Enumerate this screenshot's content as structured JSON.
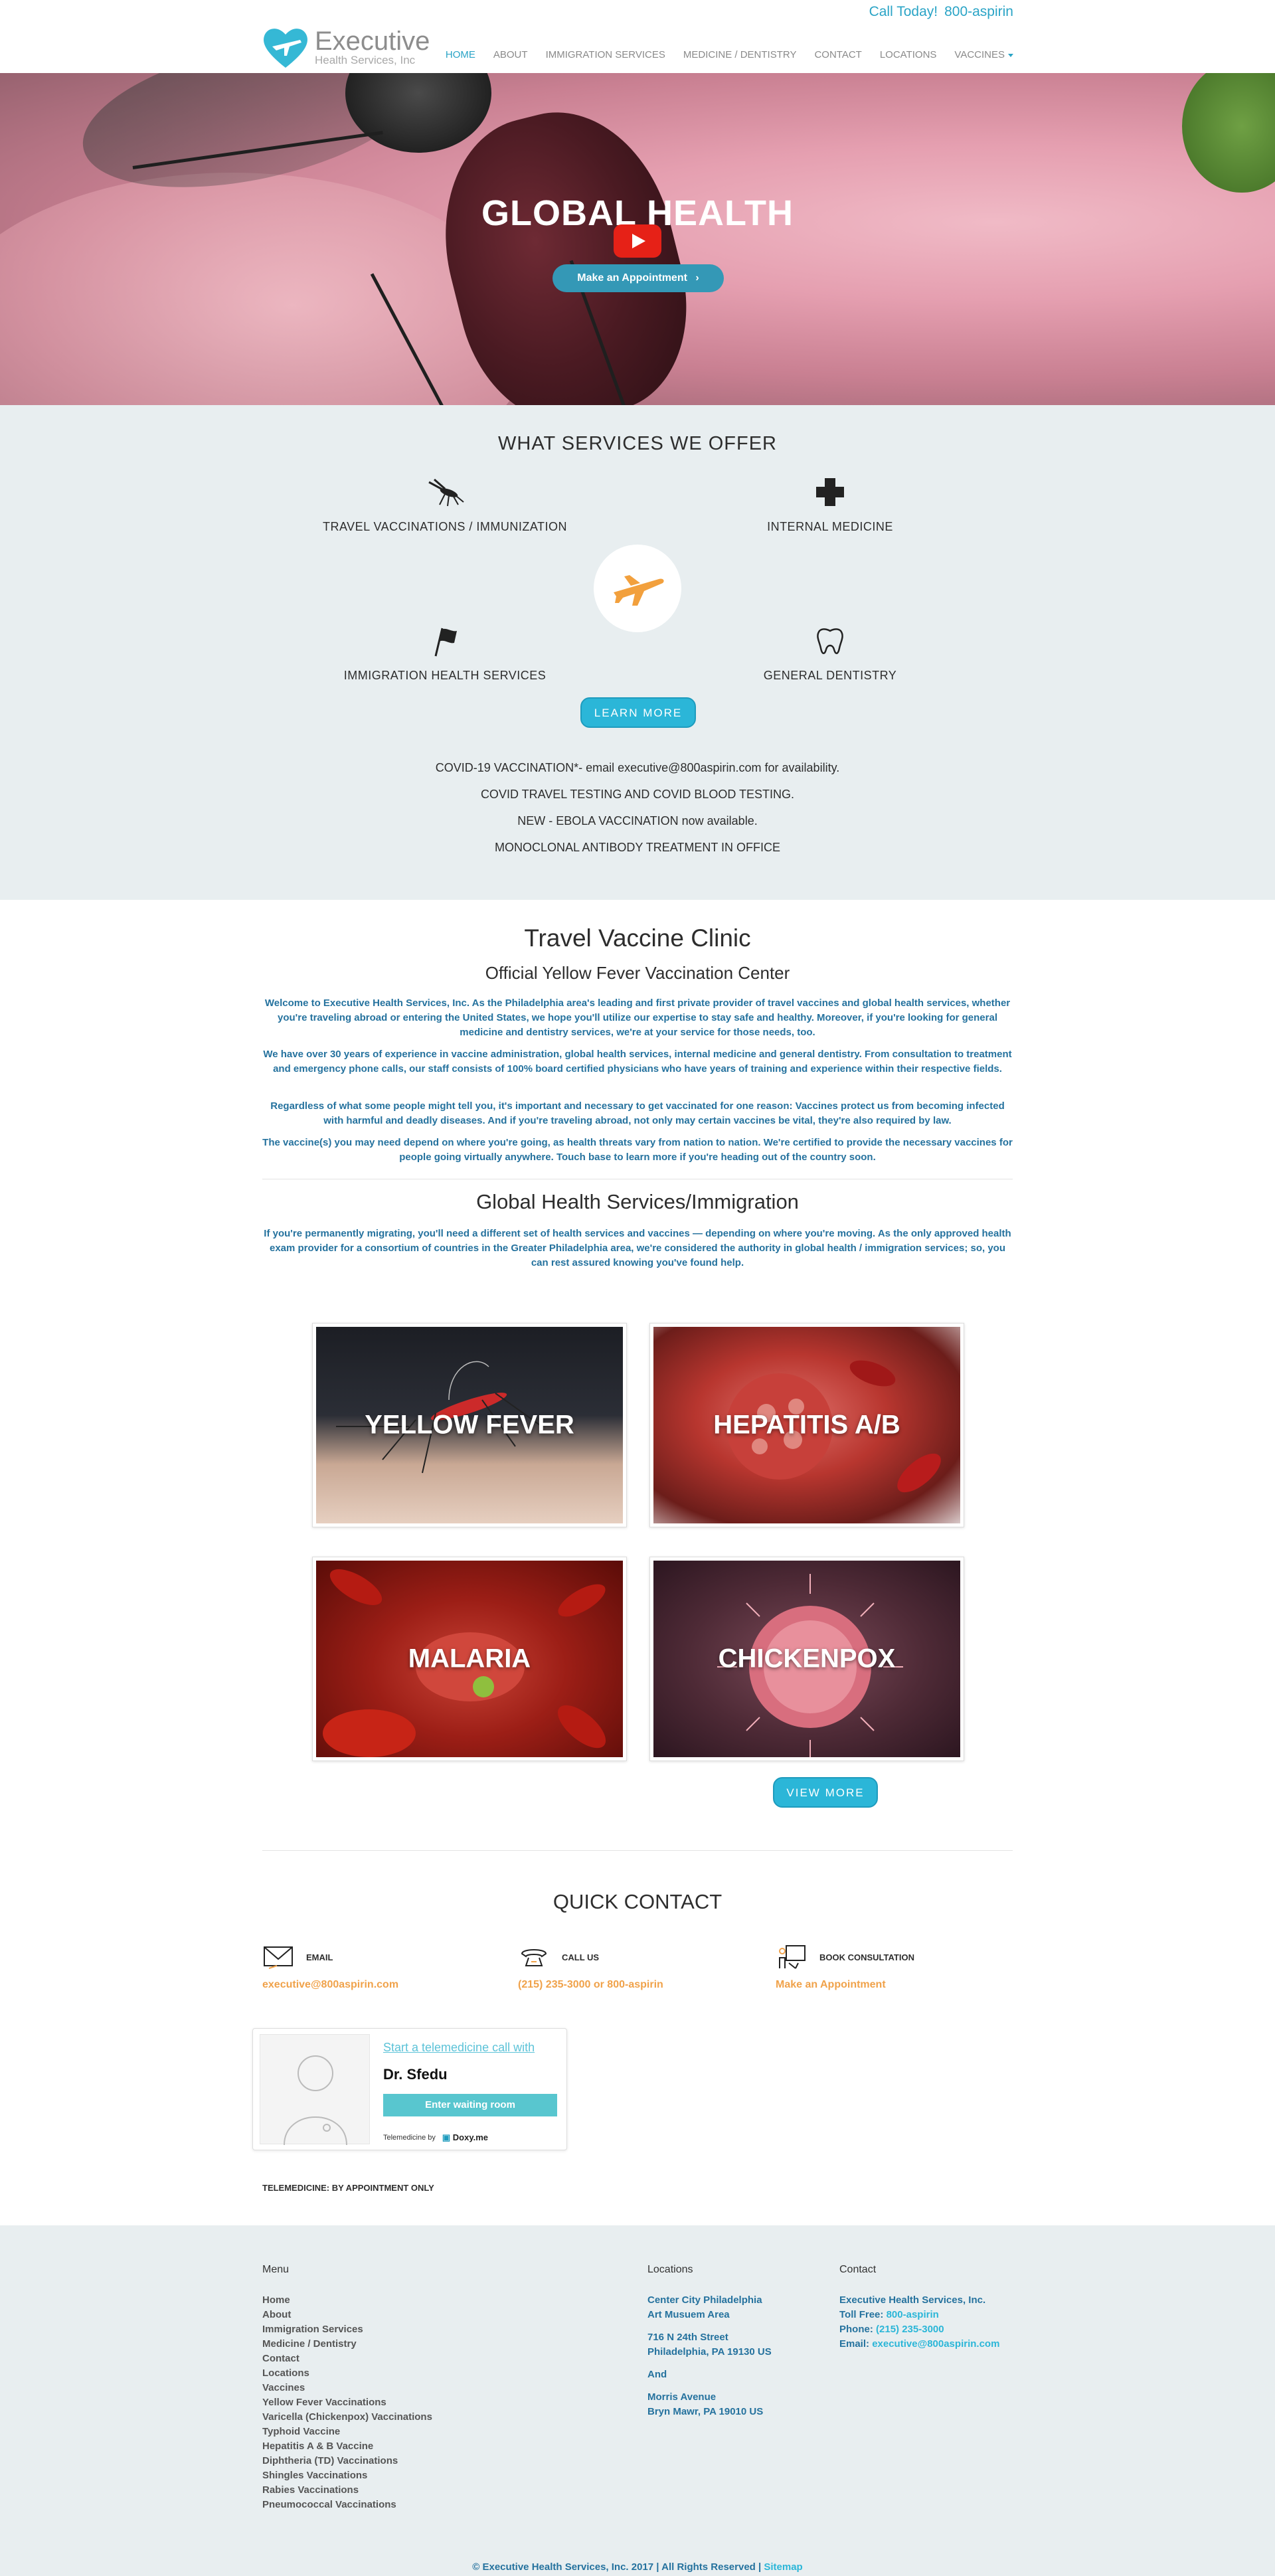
{
  "header": {
    "call_label": "Call Today!",
    "phone": "800-aspirin",
    "logo_brand": "Executive",
    "logo_sub": "Health Services, Inc",
    "nav": [
      "HOME",
      "ABOUT",
      "IMMIGRATION SERVICES",
      "MEDICINE / DENTISTRY",
      "CONTACT",
      "LOCATIONS",
      "VACCINES"
    ]
  },
  "hero": {
    "title": "GLOBAL HEALTH",
    "button": "Make an Appointment"
  },
  "services": {
    "title": "WHAT SERVICES WE OFFER",
    "items": [
      {
        "label": "TRAVEL VACCINATIONS / IMMUNIZATION",
        "icon": "mosquito-icon"
      },
      {
        "label": "INTERNAL MEDICINE",
        "icon": "medical-cross-icon"
      },
      {
        "label": "IMMIGRATION HEALTH SERVICES",
        "icon": "flag-icon"
      },
      {
        "label": "GENERAL DENTISTRY",
        "icon": "tooth-icon"
      }
    ],
    "center_icon": "airplane-icon",
    "learn_more": "LEARN MORE",
    "news": [
      "COVID-19 VACCINATION*- email executive@800aspirin.com for availability.",
      "COVID TRAVEL TESTING AND COVID BLOOD TESTING.",
      "NEW - EBOLA VACCINATION now available.",
      "MONOCLONAL ANTIBODY TREATMENT IN OFFICE"
    ]
  },
  "clinic": {
    "title": "Travel Vaccine Clinic",
    "subtitle": "Official Yellow Fever Vaccination Center",
    "paragraphs": [
      "Welcome to Executive Health Services, Inc. As the Philadelphia area's leading and first private provider of travel vaccines and global health services, whether you're traveling abroad or entering the United States, we hope you'll utilize our expertise to stay safe and healthy. Moreover, if you're looking for general medicine and dentistry services, we're at your service for those needs, too.",
      "We have over 30 years of experience in vaccine administration, global health services, internal medicine and general dentistry. From consultation to treatment and emergency phone calls, our staff consists of 100% board certified physicians who have years of training and experience within their respective fields.",
      "Regardless of what some people might tell you, it's important and necessary to get vaccinated for one reason: Vaccines protect us from becoming infected with harmful and deadly diseases. And if you're traveling abroad, not only may certain vaccines be vital, they're also required by law.",
      "The vaccine(s) you may need depend on where you're going, as health threats vary from nation to nation. We're certified to provide the necessary vaccines for people going virtually anywhere. Touch base to learn more if you're heading out of the country soon."
    ],
    "global_title": "Global Health Services/Immigration",
    "global_paragraph": "If you're permanently migrating, you'll need a different set of health services and vaccines — depending on where you're moving. As the only approved health exam provider for a consortium of countries in the Greater Philadelphia area, we're considered the authority in global health / immigration services; so, you can rest assured knowing you've found help."
  },
  "cards": [
    {
      "caption": "YELLOW FEVER"
    },
    {
      "caption": "HEPATITIS A/B"
    },
    {
      "caption": "MALARIA"
    },
    {
      "caption": "CHICKENPOX"
    }
  ],
  "view_more": "VIEW MORE",
  "quick_contact": {
    "title": "QUICK CONTACT",
    "items": [
      {
        "label": "EMAIL",
        "value": "executive@800aspirin.com",
        "icon": "envelope-icon"
      },
      {
        "label": "CALL US",
        "value": "(215) 235-3000 or 800-aspirin",
        "icon": "phone-icon"
      },
      {
        "label": "BOOK CONSULTATION",
        "value": "Make an Appointment",
        "icon": "presentation-icon"
      }
    ],
    "tele": {
      "start_link": "Start a telemedicine call with",
      "doctor": "Dr. Sfedu",
      "button": "Enter waiting room",
      "by": "Telemedicine by",
      "brand": "Doxy.me"
    },
    "note": "TELEMEDICINE: BY APPOINTMENT ONLY"
  },
  "footer": {
    "menu_title": "Menu",
    "menu": [
      "Home",
      "About",
      "Immigration Services",
      "Medicine / Dentistry",
      "Contact",
      "Locations",
      "Vaccines",
      "Yellow Fever Vaccinations",
      "Varicella (Chickenpox) Vaccinations",
      "Typhoid Vaccine",
      "Hepatitis A & B Vaccine",
      "Diphtheria (TD) Vaccinations",
      "Shingles Vaccinations",
      "Rabies Vaccinations",
      "Pneumococcal Vaccinations"
    ],
    "locations_title": "Locations",
    "loc1_a": "Center City Philadelphia",
    "loc1_b": "Art Musuem Area",
    "loc1_c": "716 N 24th Street",
    "loc1_d": "Philadelphia, PA 19130 US",
    "and": "And",
    "loc2_a": "Morris Avenue",
    "loc2_b": "Bryn Mawr, PA 19010 US",
    "contact_title": "Contact",
    "c_company": "Executive Health Services, Inc.",
    "c_toll_label": "Toll Free:",
    "c_toll": "800-aspirin",
    "c_phone_label": "Phone:",
    "c_phone": "(215) 235-3000",
    "c_email_label": "Email:",
    "c_email": "executive@800aspirin.com",
    "copyright": "© Executive Health Services, Inc. 2017 | All Rights Reserved |",
    "sitemap": "Sitemap"
  }
}
